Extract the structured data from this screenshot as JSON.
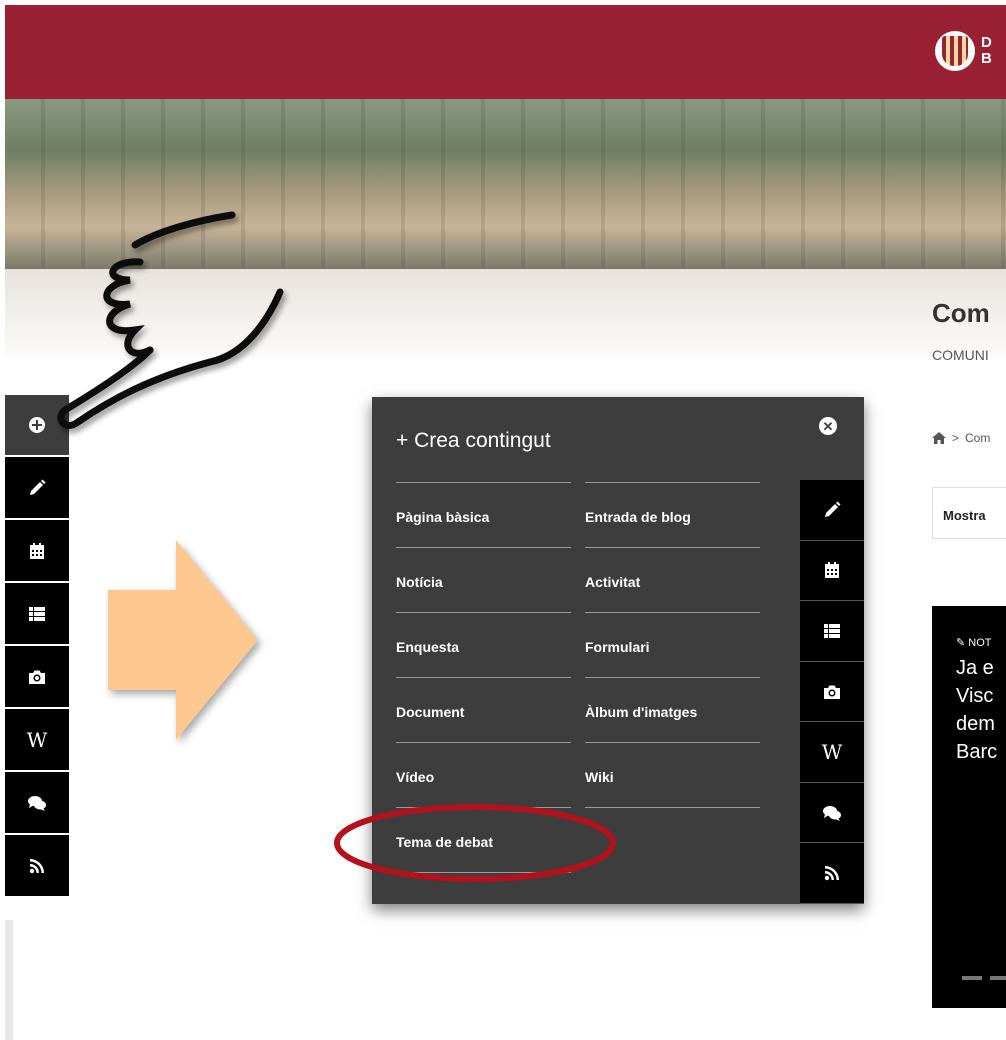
{
  "header": {
    "logo_text": "D\nB",
    "colors": {
      "brand": "#9a2033",
      "panel": "#3d3d3d",
      "toolbar": "#000000",
      "arrow": "#fcc890",
      "highlight": "#b3121c"
    }
  },
  "page": {
    "title": "Com",
    "subtitle": "COMUNI",
    "breadcrumb_sep": ">",
    "breadcrumb_item": "Com",
    "tab_label": "Mostra",
    "news_tag": "NOT",
    "news_text": "Ja e\nVisc\ndem\nBarc"
  },
  "toolbar": {
    "items": [
      {
        "icon": "plus-circle-icon"
      },
      {
        "icon": "pencil-icon"
      },
      {
        "icon": "calendar-icon"
      },
      {
        "icon": "list-icon"
      },
      {
        "icon": "camera-icon"
      },
      {
        "icon": "wikipedia-icon",
        "glyph": "W"
      },
      {
        "icon": "comments-icon"
      },
      {
        "icon": "rss-icon"
      }
    ]
  },
  "modal": {
    "title": "+  Crea contingut",
    "close_icon": "close-icon",
    "items": [
      {
        "label": "Pàgina bàsica"
      },
      {
        "label": "Entrada de blog"
      },
      {
        "label": "Notícia"
      },
      {
        "label": "Activitat"
      },
      {
        "label": "Enquesta"
      },
      {
        "label": "Formulari"
      },
      {
        "label": "Document"
      },
      {
        "label": "Àlbum d'imatges"
      },
      {
        "label": "Vídeo"
      },
      {
        "label": "Wiki"
      },
      {
        "label": "Tema de debat"
      }
    ],
    "side_icons": [
      "pencil-icon",
      "calendar-icon",
      "list-icon",
      "camera-icon",
      "wikipedia-icon",
      "comments-icon",
      "rss-icon"
    ]
  }
}
